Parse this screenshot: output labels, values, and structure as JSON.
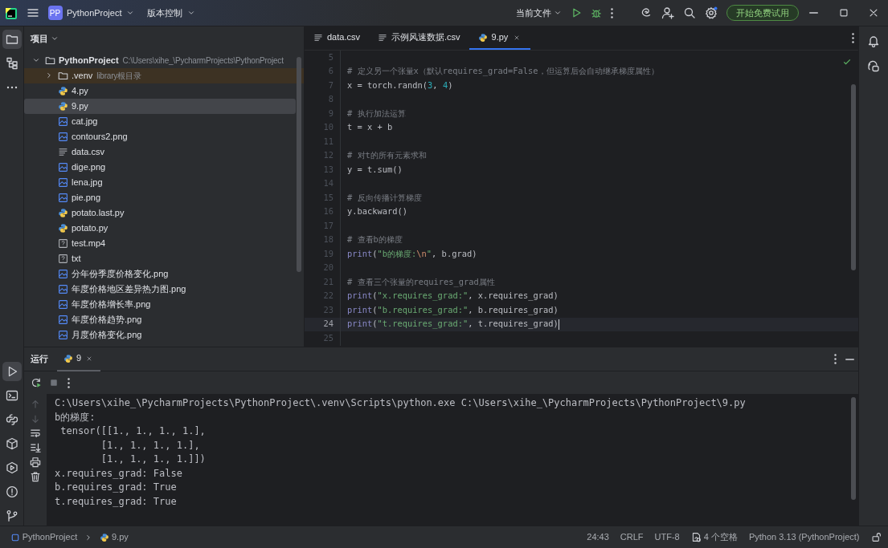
{
  "title_bar": {
    "project_badge": "PP",
    "project": "PythonProject",
    "vcs": "版本控制",
    "run_config": "当前文件",
    "trial_button": "开始免费试用"
  },
  "project_panel": {
    "title": "项目",
    "tree": [
      {
        "name": "PythonProject",
        "hint": "C:\\Users\\xihe_\\PycharmProjects\\PythonProject",
        "kind": "folder",
        "expanded": true,
        "selected": false,
        "children": [
          {
            "name": ".venv",
            "hint": "library根目录",
            "kind": "folder",
            "expanded": false,
            "selected": false,
            "excluded": true
          },
          {
            "name": "4.py",
            "kind": "python",
            "selected": false
          },
          {
            "name": "9.py",
            "kind": "python",
            "selected": true
          },
          {
            "name": "cat.jpg",
            "kind": "image",
            "selected": false
          },
          {
            "name": "contours2.png",
            "kind": "image",
            "selected": false
          },
          {
            "name": "data.csv",
            "kind": "text",
            "selected": false
          },
          {
            "name": "dige.png",
            "kind": "image",
            "selected": false
          },
          {
            "name": "lena.jpg",
            "kind": "image",
            "selected": false
          },
          {
            "name": "pie.png",
            "kind": "image",
            "selected": false
          },
          {
            "name": "potato.last.py",
            "kind": "python",
            "selected": false
          },
          {
            "name": "potato.py",
            "kind": "python",
            "selected": false
          },
          {
            "name": "test.mp4",
            "kind": "unknown",
            "selected": false
          },
          {
            "name": "txt",
            "kind": "unknown",
            "selected": false
          },
          {
            "name": "分年份季度价格变化.png",
            "kind": "image",
            "selected": false
          },
          {
            "name": "年度价格地区差异热力图.png",
            "kind": "image",
            "selected": false
          },
          {
            "name": "年度价格增长率.png",
            "kind": "image",
            "selected": false
          },
          {
            "name": "年度价格趋势.png",
            "kind": "image",
            "selected": false
          },
          {
            "name": "月度价格变化.png",
            "kind": "image",
            "selected": false
          }
        ]
      }
    ]
  },
  "editor": {
    "tabs": [
      {
        "label": "data.csv",
        "kind": "text",
        "selected": false,
        "closable": false
      },
      {
        "label": "示例风速数据.csv",
        "kind": "text",
        "selected": false,
        "closable": false
      },
      {
        "label": "9.py",
        "kind": "python",
        "selected": true,
        "closable": true
      }
    ],
    "lines": [
      {
        "number": "5",
        "current": false
      },
      {
        "number": "6",
        "current": false,
        "segments": [
          {
            "kind": "comment",
            "text": "# 定义另一个张量x（默认requires_grad=False，但运算后会自动继承梯度属性）"
          }
        ]
      },
      {
        "number": "7",
        "current": false,
        "segments": [
          {
            "kind": "plain",
            "text": "x = torch.randn("
          },
          {
            "kind": "number",
            "text": "3"
          },
          {
            "kind": "plain",
            "text": ", "
          },
          {
            "kind": "number",
            "text": "4"
          },
          {
            "kind": "plain",
            "text": ")"
          }
        ]
      },
      {
        "number": "8",
        "current": false
      },
      {
        "number": "9",
        "current": false,
        "segments": [
          {
            "kind": "comment",
            "text": "# 执行加法运算"
          }
        ]
      },
      {
        "number": "10",
        "current": false,
        "segments": [
          {
            "kind": "plain",
            "text": "t = x + b"
          }
        ]
      },
      {
        "number": "11",
        "current": false
      },
      {
        "number": "12",
        "current": false,
        "segments": [
          {
            "kind": "comment",
            "text": "# 对t的所有元素求和"
          }
        ]
      },
      {
        "number": "13",
        "current": false,
        "segments": [
          {
            "kind": "plain",
            "text": "y = t.sum()"
          }
        ]
      },
      {
        "number": "14",
        "current": false
      },
      {
        "number": "15",
        "current": false,
        "segments": [
          {
            "kind": "comment",
            "text": "# 反向传播计算梯度"
          }
        ]
      },
      {
        "number": "16",
        "current": false,
        "segments": [
          {
            "kind": "plain",
            "text": "y.backward()"
          }
        ]
      },
      {
        "number": "17",
        "current": false
      },
      {
        "number": "18",
        "current": false,
        "segments": [
          {
            "kind": "comment",
            "text": "# 查看b的梯度"
          }
        ]
      },
      {
        "number": "19",
        "current": false,
        "segments": [
          {
            "kind": "builtin",
            "text": "print"
          },
          {
            "kind": "plain",
            "text": "("
          },
          {
            "kind": "string",
            "text": "\"b的梯度:"
          },
          {
            "kind": "escape",
            "text": "\\n"
          },
          {
            "kind": "string",
            "text": "\""
          },
          {
            "kind": "plain",
            "text": ", b.grad)"
          }
        ]
      },
      {
        "number": "20",
        "current": false
      },
      {
        "number": "21",
        "current": false,
        "segments": [
          {
            "kind": "comment",
            "text": "# 查看三个张量的requires_grad属性"
          }
        ]
      },
      {
        "number": "22",
        "current": false,
        "segments": [
          {
            "kind": "builtin",
            "text": "print"
          },
          {
            "kind": "plain",
            "text": "("
          },
          {
            "kind": "string",
            "text": "\"x.requires_grad:\""
          },
          {
            "kind": "plain",
            "text": ", x.requires_grad)"
          }
        ]
      },
      {
        "number": "23",
        "current": false,
        "segments": [
          {
            "kind": "builtin",
            "text": "print"
          },
          {
            "kind": "plain",
            "text": "("
          },
          {
            "kind": "string",
            "text": "\"b.requires_grad:\""
          },
          {
            "kind": "plain",
            "text": ", b.requires_grad)"
          }
        ]
      },
      {
        "number": "24",
        "current": true,
        "segments": [
          {
            "kind": "builtin",
            "text": "print"
          },
          {
            "kind": "plain",
            "text": "("
          },
          {
            "kind": "string",
            "text": "\"t.requires_grad:\""
          },
          {
            "kind": "plain",
            "text": ", t.requires_grad)"
          }
        ]
      },
      {
        "number": "25",
        "current": false
      }
    ]
  },
  "run_panel": {
    "title": "运行",
    "tabs": [
      {
        "label": "9",
        "selected": true
      }
    ],
    "output": [
      "C:\\Users\\xihe_\\PycharmProjects\\PythonProject\\.venv\\Scripts\\python.exe C:\\Users\\xihe_\\PycharmProjects\\PythonProject\\9.py",
      "b的梯度:",
      " tensor([[1., 1., 1., 1.],",
      "        [1., 1., 1., 1.],",
      "        [1., 1., 1., 1.]])",
      "x.requires_grad: False",
      "b.requires_grad: True",
      "t.requires_grad: True"
    ]
  },
  "breadcrumbs": [
    {
      "label": "PythonProject",
      "kind": "module"
    },
    {
      "label": "9.py",
      "kind": "python"
    }
  ],
  "status_bar": [
    {
      "label": "24:43",
      "kind": "plain"
    },
    {
      "label": "CRLF",
      "kind": "plain"
    },
    {
      "label": "UTF-8",
      "kind": "plain"
    },
    {
      "label": "4 个空格",
      "kind": "indent"
    },
    {
      "label": "Python 3.13 (PythonProject)",
      "kind": "plain"
    }
  ]
}
